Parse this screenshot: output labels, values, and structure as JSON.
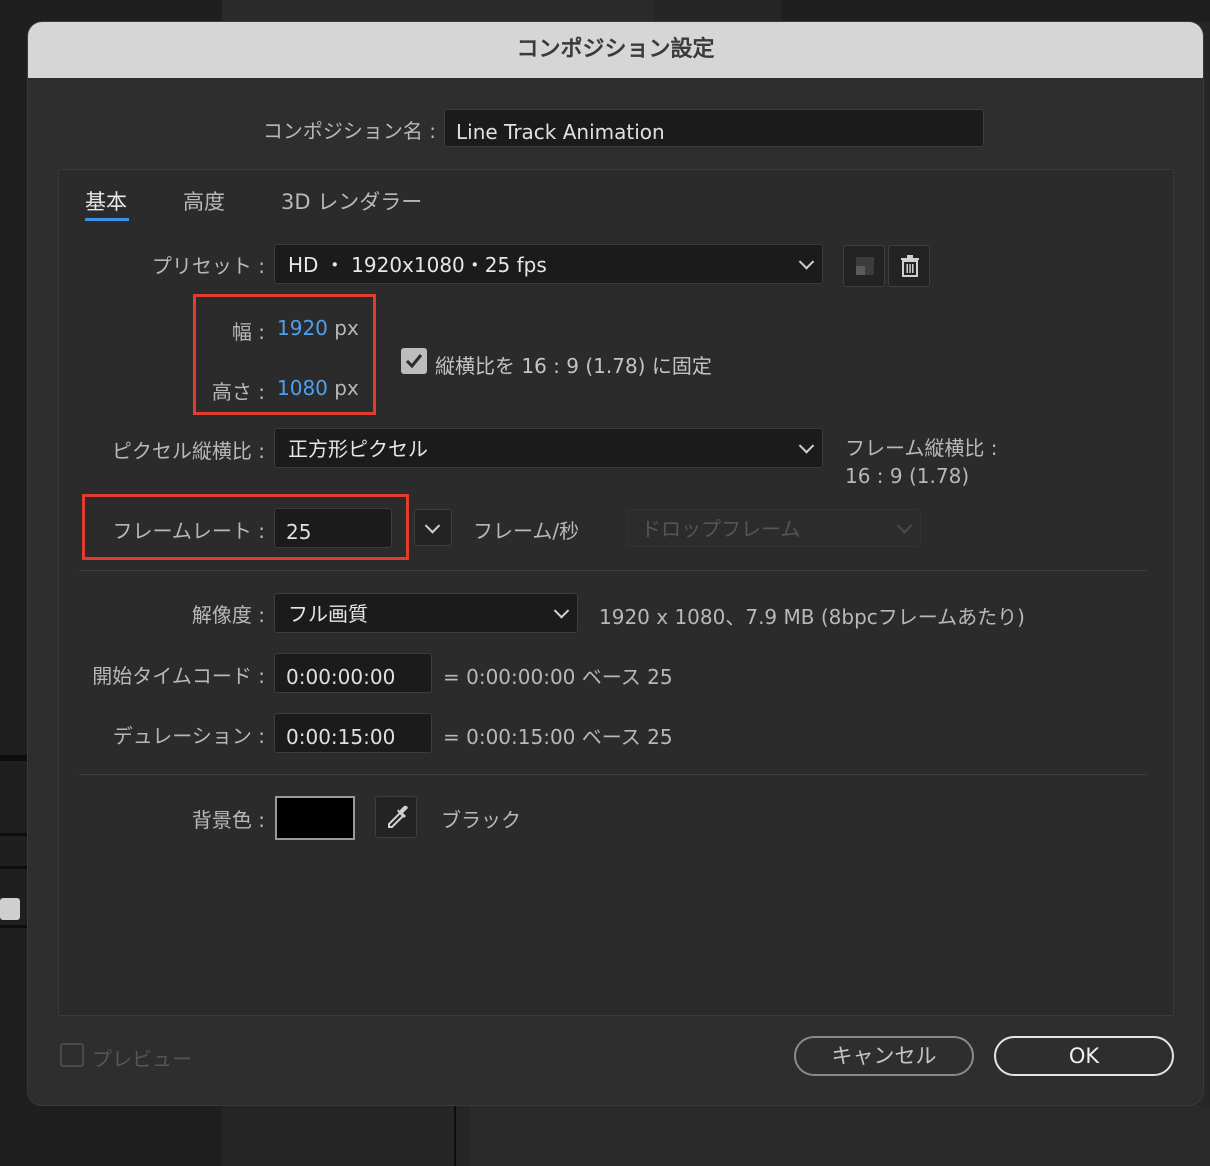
{
  "dialog": {
    "title": "コンポジション設定",
    "comp_name_label": "コンポジション名 :",
    "comp_name_value": "Line Track Animation"
  },
  "tabs": [
    {
      "label": "基本",
      "active": true
    },
    {
      "label": "高度",
      "active": false
    },
    {
      "label": "3D レンダラー",
      "active": false
    }
  ],
  "preset": {
    "label": "プリセット :",
    "value": "HD ・ 1920x1080・25 fps"
  },
  "size": {
    "width_label": "幅 :",
    "width_value": "1920",
    "height_label": "高さ :",
    "height_value": "1080",
    "unit": "px",
    "lock_aspect_label": "縦横比を 16 : 9 (1.78) に固定",
    "lock_aspect_checked": true
  },
  "pixel_aspect": {
    "label": "ピクセル縦横比 :",
    "value": "正方形ピクセル",
    "frame_aspect_label": "フレーム縦横比 :",
    "frame_aspect_value": "16 : 9 (1.78)"
  },
  "frame_rate": {
    "label": "フレームレート :",
    "value": "25",
    "unit_label": "フレーム/秒",
    "drop_frame": "ドロップフレーム"
  },
  "resolution": {
    "label": "解像度 :",
    "value": "フル画質",
    "info": "1920 x 1080、7.9 MB (8bpcフレームあたり)"
  },
  "start_timecode": {
    "label": "開始タイムコード :",
    "value": "0:00:00:00",
    "info": "= 0:00:00:00  ベース 25"
  },
  "duration": {
    "label": "デュレーション :",
    "value": "0:00:15:00",
    "info": "= 0:00:15:00  ベース 25"
  },
  "background": {
    "label": "背景色 :",
    "color": "#000000",
    "color_name": "ブラック"
  },
  "footer": {
    "preview_label": "プレビュー",
    "cancel_label": "キャンセル",
    "ok_label": "OK"
  },
  "colors": {
    "accent": "#3b8fe6",
    "highlight_box": "#e03d2f",
    "value_blue": "#4ea0ee"
  }
}
